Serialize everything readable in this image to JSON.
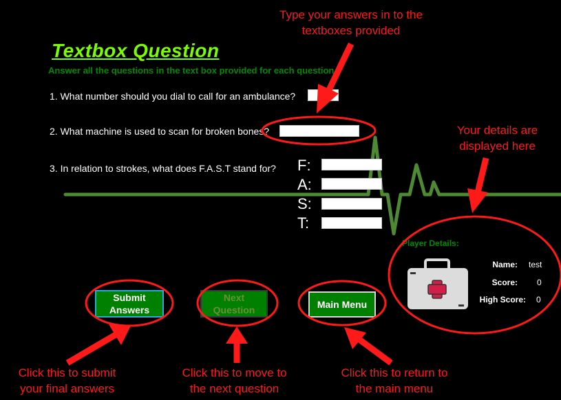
{
  "page": {
    "title": "Textbox Question",
    "subtitle": "Answer all the questions in the text box provided for each question."
  },
  "questions": [
    {
      "text": "1. What number should you dial to call for an ambulance?",
      "answer": ""
    },
    {
      "text": "2. What machine is used to scan for broken bones?",
      "answer": ""
    },
    {
      "text": "3. In relation to strokes, what does F.A.S.T stand for?",
      "answer": ""
    }
  ],
  "fast": {
    "letters": [
      "F:",
      "A:",
      "S:",
      "T:"
    ],
    "answers": [
      "",
      "",
      "",
      ""
    ]
  },
  "buttons": {
    "submit_line1": "Submit",
    "submit_line2": "Answers",
    "next_line1": "Next",
    "next_line2": "Question",
    "main_menu": "Main Menu"
  },
  "player": {
    "heading": "Player Details:",
    "name_label": "Name:",
    "name_value": "test",
    "score_label": "Score:",
    "score_value": "0",
    "high_label": "High Score:",
    "high_value": "0"
  },
  "annotations": {
    "textboxes_1": "Type your answers in to the",
    "textboxes_2": "textboxes provided",
    "details_1": "Your details are",
    "details_2": "displayed here",
    "submit_1": "Click this to submit",
    "submit_2": "your final answers",
    "next_1": "Click this to move to",
    "next_2": "the next question",
    "menu_1": "Click this to return to",
    "menu_2": "the main menu"
  },
  "icons": {
    "ecg": "ecg-heartbeat-line",
    "kit": "first-aid-kit-icon"
  },
  "colors": {
    "title": "#7cfc00",
    "subtitle": "#008a00",
    "button_green": "#008000",
    "annotation_red": "#ff1a1a",
    "ecg_green": "#5a9a3a"
  }
}
